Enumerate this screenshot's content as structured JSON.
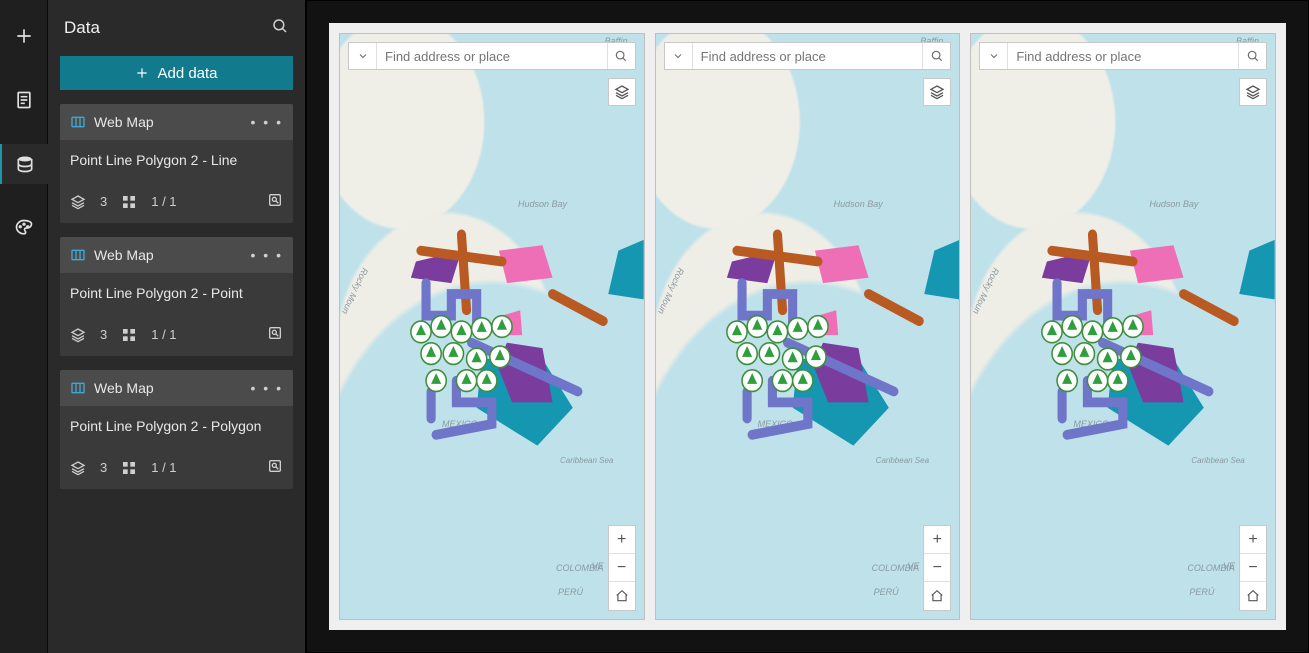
{
  "panel": {
    "title": "Data",
    "addButton": "Add data",
    "cards": [
      {
        "source": "Web Map",
        "title": "Point Line Polygon 2 - Line",
        "layers": "3",
        "widgets": "1 / 1"
      },
      {
        "source": "Web Map",
        "title": "Point Line Polygon 2 - Point",
        "layers": "3",
        "widgets": "1 / 1"
      },
      {
        "source": "Web Map",
        "title": "Point Line Polygon 2 - Polygon",
        "layers": "3",
        "widgets": "1 / 1"
      }
    ]
  },
  "map": {
    "searchPlaceholder": "Find address or place",
    "labels": {
      "baffin": "Baffin",
      "hudson": "Hudson Bay",
      "mexico": "MEXICO",
      "colombia": "COLOMBIA",
      "peru": "PERÚ",
      "caribbean": "Caribbean Sea",
      "rocky": "Rocky Moun",
      "vr": "VE"
    }
  },
  "colors": {
    "accent": "#127a8d",
    "line_brown": "#b95a23",
    "line_purple": "#6f75c9",
    "poly_teal": "#1596b1",
    "poly_violet": "#7a3d9e",
    "poly_pink": "#ef6fb6",
    "point_green": "#2e9e3f"
  }
}
